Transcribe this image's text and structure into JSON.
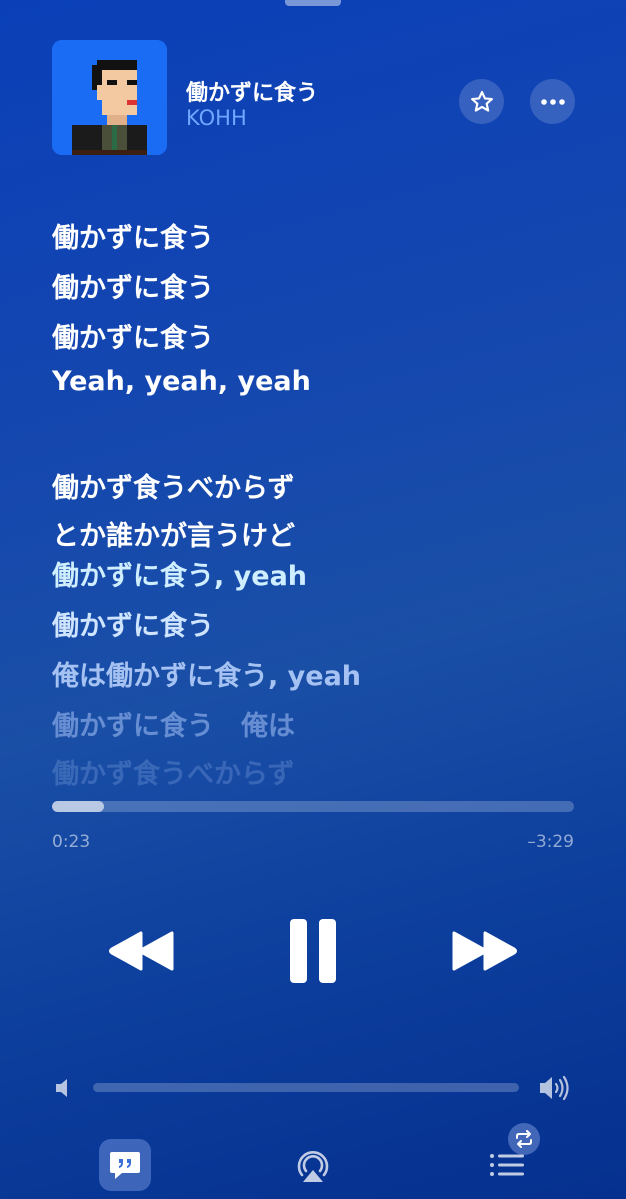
{
  "now_playing": {
    "title": "働かずに食う",
    "artist": "KOHH"
  },
  "lyrics": [
    {
      "text": "働かずに食う",
      "state": "past"
    },
    {
      "text": "働かずに食う",
      "state": "past"
    },
    {
      "text": "働かずに食う",
      "state": "past"
    },
    {
      "text": "Yeah, yeah, yeah",
      "state": "past"
    },
    {
      "text": "働かず食うべからず",
      "state": "current"
    },
    {
      "text": "とか誰かが言うけど",
      "state": "current"
    },
    {
      "text": "働かずに食う, yeah",
      "state": "next"
    },
    {
      "text": "働かずに食う",
      "state": "upcoming"
    },
    {
      "text": "俺は働かずに食う, yeah",
      "state": "upcoming"
    },
    {
      "text": "働かずに食う　俺は",
      "state": "faded"
    },
    {
      "text": "働かず食うべからず",
      "state": "faded"
    }
  ],
  "playback": {
    "elapsed": "0:23",
    "remaining": "–3:29",
    "progress_fraction": 0.1
  },
  "volume": {
    "level_fraction": 0.0
  },
  "icons": {
    "favorite": "star-icon",
    "more": "ellipsis-icon",
    "rewind": "rewind-icon",
    "pause": "pause-icon",
    "forward": "fast-forward-icon",
    "volume_low": "speaker-low-icon",
    "volume_high": "speaker-high-icon",
    "lyrics_tab": "quote-bubble-icon",
    "airplay_tab": "airplay-icon",
    "queue_tab": "list-icon",
    "repeat": "repeat-icon"
  },
  "colors": {
    "background_top": "#0a3fb8",
    "background_bottom": "#05308f",
    "artist_accent": "#6fa6ff",
    "next_lyric": "#cfeeff"
  }
}
